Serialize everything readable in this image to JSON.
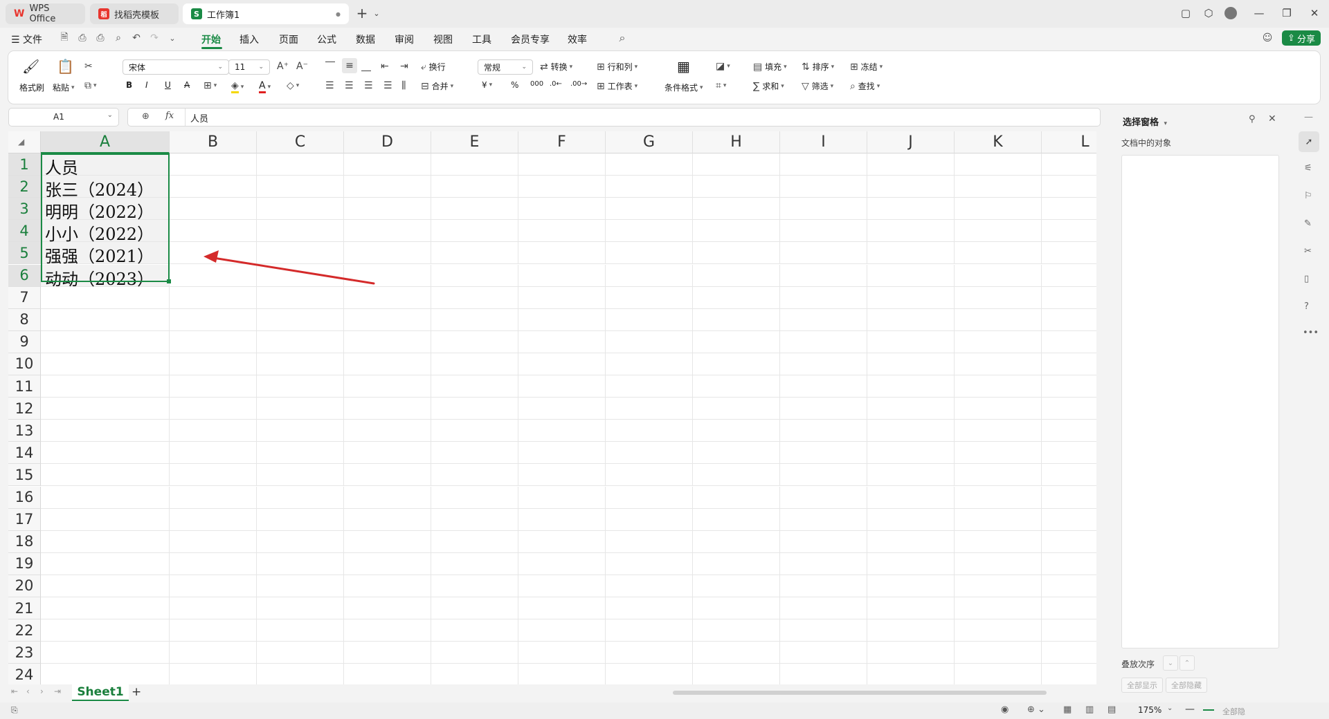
{
  "titlebar": {
    "tabs": [
      {
        "label": "WPS Office",
        "state": "inactive",
        "logo": "W",
        "logo_color": "#e8352e"
      },
      {
        "label": "找稻壳模板",
        "state": "inactive",
        "logo": "稻",
        "logo_color": "#e8352e"
      },
      {
        "label": "工作簿1",
        "state": "active",
        "logo": "S",
        "logo_color": "#1a8a45",
        "modified_dot": "●"
      }
    ],
    "new_tab": "+",
    "new_tab_menu": "⌄"
  },
  "menubar": {
    "file": "文件",
    "items": [
      "开始",
      "插入",
      "页面",
      "公式",
      "数据",
      "审阅",
      "视图",
      "工具",
      "会员专享",
      "效率"
    ],
    "active": "开始",
    "share": "分享",
    "accent": "#1a8a45"
  },
  "ribbon": {
    "format_painter": "格式刷",
    "paste": "粘贴",
    "font_name": "宋体",
    "font_size": "11",
    "bold": "B",
    "italic": "I",
    "underline": "U",
    "strike": "A",
    "wrap": "换行",
    "merge": "合并",
    "number_format": "常规",
    "convert": "转换",
    "row_col": "行和列",
    "worksheet": "工作表",
    "cond_format": "条件格式",
    "fill": "填充",
    "sort": "排序",
    "freeze": "冻结",
    "sum": "求和",
    "filter": "筛选",
    "find": "查找",
    "currency": "¥",
    "percent": "%"
  },
  "formula": {
    "cell_ref": "A1",
    "fx": "fx",
    "content": "人员"
  },
  "grid": {
    "columns": [
      "A",
      "B",
      "C",
      "D",
      "E",
      "F",
      "G",
      "H",
      "I",
      "J",
      "K",
      "L"
    ],
    "selected_column": "A",
    "rows": [
      "1",
      "2",
      "3",
      "4",
      "5",
      "6",
      "7",
      "8",
      "9",
      "10",
      "11",
      "12",
      "13",
      "14",
      "15",
      "16",
      "17",
      "18",
      "19",
      "20",
      "21",
      "22",
      "23",
      "24"
    ],
    "selected_rows": [
      "1",
      "2",
      "3",
      "4",
      "5",
      "6"
    ],
    "cells_A": [
      "人员",
      "张三（2024）",
      "明明（2022）",
      "小小（2022）",
      "强强（2021）",
      "动动（2023）"
    ],
    "selection_color": "#1a8a45",
    "annotation_arrow_color": "#d42a2a"
  },
  "sheets": {
    "tabs": [
      "Sheet1"
    ],
    "add": "+"
  },
  "statusbar": {
    "zoom": "175%",
    "fullscreen": "全部隐"
  },
  "pane": {
    "title": "选择窗格",
    "subtitle": "文档中的对象",
    "order_label": "叠放次序",
    "show_all": "全部显示",
    "hide_all": "全部隐藏"
  }
}
